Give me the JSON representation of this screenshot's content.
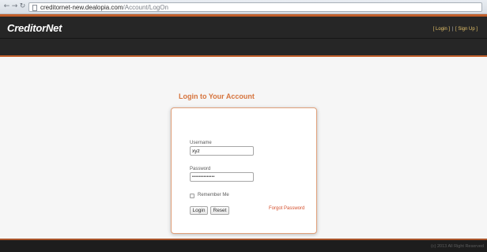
{
  "browser": {
    "url_host": "creditornet-new.dealopia.com",
    "url_path": "/Account/LogOn",
    "back_icon": "arrow-left-icon",
    "forward_icon": "arrow-right-icon",
    "reload_icon": "reload-icon"
  },
  "header": {
    "logo": "CreditorNet",
    "login_link": "[ Login ]",
    "separator": "|",
    "signup_link": "[ Sign Up ]"
  },
  "login": {
    "title": "Login to Your Account",
    "username_label": "Username",
    "username_value": "xyz",
    "password_label": "Password",
    "password_value": "••••••••••••••",
    "remember_label": "Remember Me",
    "login_button": "Login",
    "reset_button": "Reset",
    "forgot_link": "Forgot Password"
  },
  "footer": {
    "text": "(c) 2013 All Right Reserved"
  },
  "colors": {
    "accent": "#d6743d",
    "header_bg": "#262626",
    "link": "#d4502e"
  }
}
